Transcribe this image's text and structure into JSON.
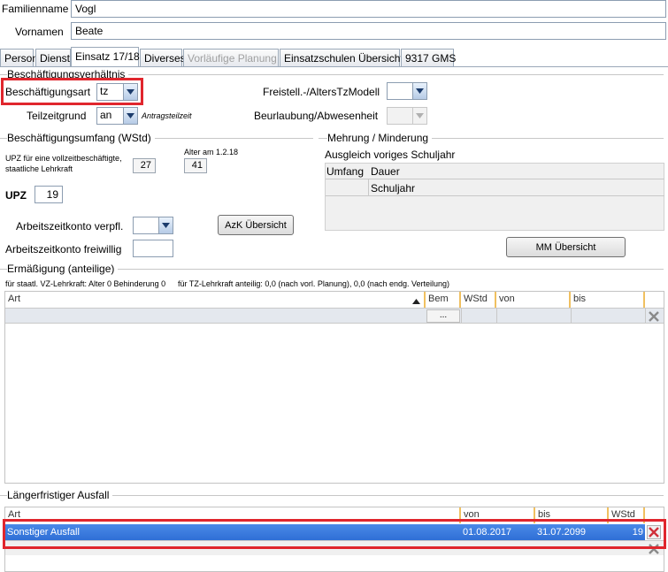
{
  "header": {
    "familienname_label": "Familienname",
    "familienname_value": "Vogl",
    "vornamen_label": "Vornamen",
    "vornamen_value": "Beate"
  },
  "tabs": [
    {
      "label": "Person"
    },
    {
      "label": "Dienst"
    },
    {
      "label": "Einsatz 17/18"
    },
    {
      "label": "Diverses"
    },
    {
      "label": "Vorläufige Planung"
    },
    {
      "label": "Einsatzschulen Übersicht"
    },
    {
      "label": "9317 GMS"
    }
  ],
  "beschaeftigung": {
    "section_title": "Beschäftigungsverhältnis",
    "art_label": "Beschäftigungsart",
    "art_value": "tz",
    "teilzeit_label": "Teilzeitgrund",
    "teilzeit_value": "an",
    "antrag_label": "Antragsteilzeit",
    "freistell_label": "Freistell.-/AltersTzModell",
    "beurlaubung_label": "Beurlaubung/Abwesenheit"
  },
  "umfang": {
    "section_title": "Beschäftigungsumfang (WStd)",
    "upz_desc": "UPZ für eine vollzeitbeschäftigte, staatliche Lehrkraft",
    "upz_desc_line1": "UPZ für eine vollzeitbeschäftigte,",
    "upz_desc_line2": "staatliche Lehrkraft",
    "upz_full_value": "27",
    "alter_label": "Alter am 1.2.18",
    "alter_value": "41",
    "upz_label": "UPZ",
    "upz_value": "19",
    "azk_verpfl_label": "Arbeitszeitkonto verpfl.",
    "azk_freiwillig_label": "Arbeitszeitkonto freiwillig",
    "azk_button": "AzK Übersicht"
  },
  "mehrung": {
    "section_title": "Mehrung / Minderung",
    "ausgleich_label": "Ausgleich voriges Schuljahr",
    "col_umfang": "Umfang",
    "col_dauer": "Dauer",
    "sub_schuljahr": "Schuljahr",
    "mm_button": "MM Übersicht"
  },
  "ermaessigung": {
    "section_title": "Ermäßigung (anteilige)",
    "info_left": "für staatl. VZ-Lehrkraft: Alter 0 Behinderung 0",
    "info_right": "für TZ-Lehrkraft anteilig: 0,0 (nach vorl. Planung), 0,0 (nach endg. Verteilung)",
    "columns": [
      "Art",
      "Bem",
      "WStd",
      "von",
      "bis"
    ],
    "ellipsis": "..."
  },
  "ausfall": {
    "section_title": "Längerfristiger Ausfall",
    "columns": [
      "Art",
      "von",
      "bis",
      "WStd"
    ],
    "rows": [
      {
        "art": "Sonstiger Ausfall",
        "von": "01.08.2017",
        "bis": "31.07.2099",
        "wstd": "19"
      }
    ]
  },
  "colors": {
    "highlight_red": "#e0262d",
    "selection_blue": "#3a7be0"
  }
}
